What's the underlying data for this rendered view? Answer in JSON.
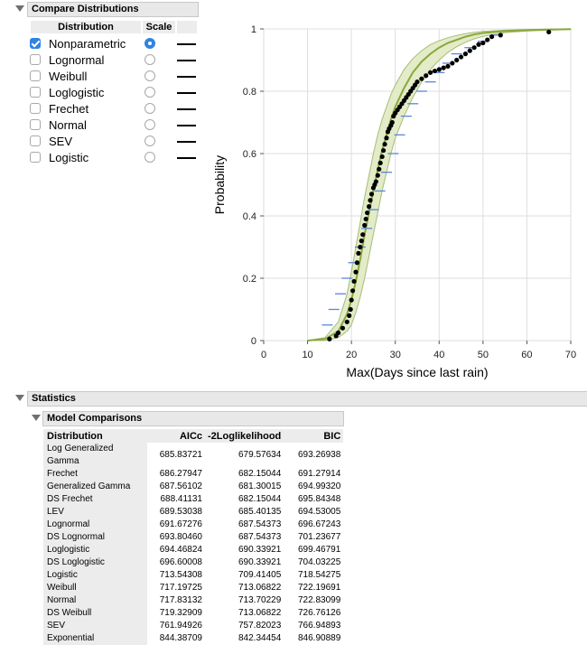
{
  "compare": {
    "title": "Compare Distributions",
    "col_distribution": "Distribution",
    "col_scale": "Scale",
    "items": [
      {
        "label": "Nonparametric",
        "checked": true,
        "scale": true
      },
      {
        "label": "Lognormal",
        "checked": false,
        "scale": false
      },
      {
        "label": "Weibull",
        "checked": false,
        "scale": false
      },
      {
        "label": "Loglogistic",
        "checked": false,
        "scale": false
      },
      {
        "label": "Frechet",
        "checked": false,
        "scale": false
      },
      {
        "label": "Normal",
        "checked": false,
        "scale": false
      },
      {
        "label": "SEV",
        "checked": false,
        "scale": false
      },
      {
        "label": "Logistic",
        "checked": false,
        "scale": false
      }
    ]
  },
  "colors": {
    "accent": "#2f83e4",
    "band_fill": "#e3ebc9",
    "band_edge": "#a6bd76",
    "fit_line": "#88a83a",
    "interval_marks": "#5b86d8",
    "points": "#000000"
  },
  "chart_data": {
    "type": "scatter",
    "xlabel": "Max(Days since last rain)",
    "ylabel": "Probability",
    "xlim": [
      0,
      70
    ],
    "ylim": [
      0,
      1
    ],
    "x_ticks": [
      0,
      10,
      20,
      30,
      40,
      50,
      60,
      70
    ],
    "y_ticks": [
      0,
      0.2,
      0.4,
      0.6,
      0.8,
      1
    ],
    "grid": true,
    "fitted_cdf": {
      "x": [
        10,
        14,
        17,
        19,
        20,
        21,
        22,
        23,
        24,
        25,
        26,
        27,
        28,
        29,
        30,
        32,
        34,
        36,
        38,
        40,
        42,
        44,
        46,
        48,
        50,
        55,
        60,
        65,
        70
      ],
      "y": [
        0.0,
        0.005,
        0.03,
        0.085,
        0.13,
        0.19,
        0.26,
        0.34,
        0.41,
        0.48,
        0.55,
        0.61,
        0.66,
        0.71,
        0.75,
        0.81,
        0.86,
        0.895,
        0.92,
        0.94,
        0.955,
        0.965,
        0.975,
        0.982,
        0.987,
        0.993,
        0.996,
        0.998,
        0.999
      ]
    },
    "band_upper": {
      "x": [
        10,
        14,
        17,
        19,
        20,
        21,
        22,
        23,
        24,
        25,
        26,
        27,
        28,
        29,
        30,
        32,
        34,
        36,
        38,
        40,
        42,
        44,
        46,
        48,
        50,
        55,
        60,
        65,
        70
      ],
      "y": [
        0.0,
        0.01,
        0.06,
        0.15,
        0.22,
        0.3,
        0.38,
        0.46,
        0.53,
        0.6,
        0.66,
        0.71,
        0.75,
        0.79,
        0.82,
        0.87,
        0.905,
        0.93,
        0.95,
        0.962,
        0.972,
        0.979,
        0.985,
        0.989,
        0.992,
        0.996,
        0.998,
        0.999,
        1.0
      ]
    },
    "band_lower": {
      "x": [
        10,
        14,
        17,
        19,
        20,
        21,
        22,
        23,
        24,
        25,
        26,
        27,
        28,
        29,
        30,
        32,
        34,
        36,
        38,
        40,
        42,
        44,
        46,
        48,
        50,
        55,
        60,
        65,
        70
      ],
      "y": [
        0.0,
        0.0,
        0.01,
        0.03,
        0.05,
        0.09,
        0.14,
        0.2,
        0.27,
        0.34,
        0.41,
        0.48,
        0.54,
        0.6,
        0.65,
        0.72,
        0.78,
        0.83,
        0.87,
        0.9,
        0.925,
        0.943,
        0.957,
        0.968,
        0.976,
        0.988,
        0.993,
        0.996,
        0.998
      ]
    },
    "points": {
      "x": [
        15,
        16.5,
        17,
        18,
        19,
        19.5,
        19.8,
        20,
        20.3,
        20.6,
        21,
        21.3,
        21.6,
        22,
        22.3,
        22.6,
        23,
        23.3,
        23.6,
        24,
        24.3,
        24.6,
        25,
        25.3,
        25.6,
        26,
        26.3,
        26.6,
        27,
        27.3,
        27.6,
        28,
        28.3,
        28.6,
        29,
        29.3,
        29.6,
        30,
        30.5,
        31,
        31.5,
        32,
        32.5,
        33,
        33.5,
        34,
        34.5,
        35,
        36,
        37,
        38,
        39,
        40,
        41,
        42,
        43,
        44,
        45,
        46,
        47,
        48,
        49,
        50,
        51,
        52,
        54,
        65
      ],
      "y": [
        0.005,
        0.015,
        0.025,
        0.04,
        0.06,
        0.08,
        0.1,
        0.13,
        0.16,
        0.19,
        0.22,
        0.25,
        0.28,
        0.3,
        0.32,
        0.34,
        0.37,
        0.39,
        0.41,
        0.43,
        0.45,
        0.47,
        0.49,
        0.5,
        0.51,
        0.53,
        0.55,
        0.57,
        0.59,
        0.61,
        0.63,
        0.65,
        0.67,
        0.68,
        0.69,
        0.7,
        0.72,
        0.73,
        0.74,
        0.75,
        0.76,
        0.77,
        0.78,
        0.79,
        0.8,
        0.81,
        0.82,
        0.83,
        0.84,
        0.85,
        0.86,
        0.865,
        0.87,
        0.875,
        0.88,
        0.89,
        0.9,
        0.91,
        0.92,
        0.93,
        0.94,
        0.95,
        0.955,
        0.965,
        0.975,
        0.98,
        0.99
      ]
    },
    "interval_marks": {
      "x": [
        14.5,
        16,
        17.5,
        19,
        20.5,
        22,
        23.5,
        25,
        26.5,
        28,
        29.5,
        31,
        32.5,
        34,
        36,
        38,
        40,
        42,
        44,
        47,
        50,
        53
      ],
      "y": [
        0.05,
        0.1,
        0.15,
        0.2,
        0.25,
        0.3,
        0.36,
        0.42,
        0.48,
        0.54,
        0.6,
        0.66,
        0.72,
        0.76,
        0.8,
        0.83,
        0.86,
        0.89,
        0.92,
        0.94,
        0.96,
        0.98
      ]
    }
  },
  "statistics": {
    "title": "Statistics",
    "model_comparisons": {
      "title": "Model Comparisons",
      "headers": [
        "Distribution",
        "AICc",
        "-2Loglikelihood",
        "BIC"
      ],
      "rows": [
        [
          "Log Generalized Gamma",
          "685.83721",
          "679.57634",
          "693.26938"
        ],
        [
          "Frechet",
          "686.27947",
          "682.15044",
          "691.27914"
        ],
        [
          "Generalized Gamma",
          "687.56102",
          "681.30015",
          "694.99320"
        ],
        [
          "DS Frechet",
          "688.41131",
          "682.15044",
          "695.84348"
        ],
        [
          "LEV",
          "689.53038",
          "685.40135",
          "694.53005"
        ],
        [
          "Lognormal",
          "691.67276",
          "687.54373",
          "696.67243"
        ],
        [
          "DS Lognormal",
          "693.80460",
          "687.54373",
          "701.23677"
        ],
        [
          "Loglogistic",
          "694.46824",
          "690.33921",
          "699.46791"
        ],
        [
          "DS Loglogistic",
          "696.60008",
          "690.33921",
          "704.03225"
        ],
        [
          "Logistic",
          "713.54308",
          "709.41405",
          "718.54275"
        ],
        [
          "Weibull",
          "717.19725",
          "713.06822",
          "722.19691"
        ],
        [
          "Normal",
          "717.83132",
          "713.70229",
          "722.83099"
        ],
        [
          "DS Weibull",
          "719.32909",
          "713.06822",
          "726.76126"
        ],
        [
          "SEV",
          "761.94926",
          "757.82023",
          "766.94893"
        ],
        [
          "Exponential",
          "844.38709",
          "842.34454",
          "846.90889"
        ]
      ]
    }
  }
}
